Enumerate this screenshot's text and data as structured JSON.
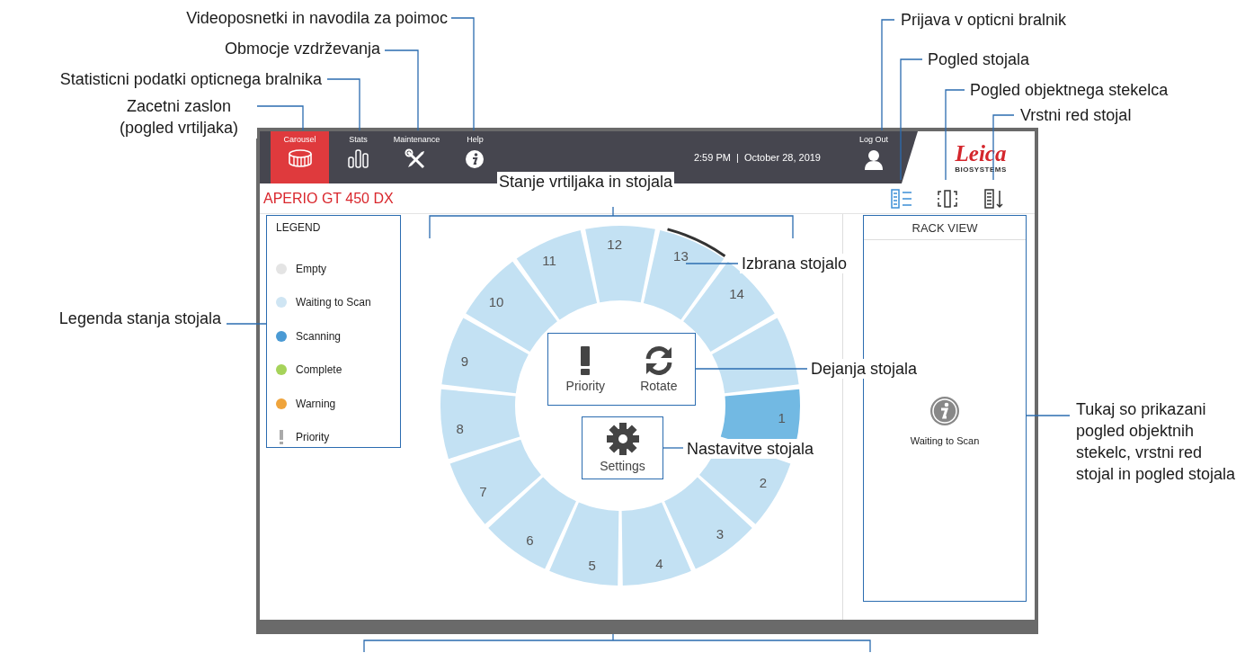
{
  "header": {
    "tabs": [
      {
        "label": "Carousel",
        "kind": "carousel",
        "selected": true
      },
      {
        "label": "Stats",
        "kind": "stats",
        "selected": false
      },
      {
        "label": "Maintenance",
        "kind": "maintenance",
        "selected": false
      },
      {
        "label": "Help",
        "kind": "help",
        "selected": false
      }
    ],
    "datetime": "2:59 PM  |  October 28, 2019",
    "logout": "Log Out",
    "logo": {
      "name": "Leica",
      "subtitle": "BIOSYSTEMS"
    }
  },
  "toolbar": {
    "title": "APERIO GT 450 DX",
    "views": [
      {
        "kind": "rack",
        "selected": true
      },
      {
        "kind": "slide",
        "selected": false
      },
      {
        "kind": "order",
        "selected": false
      }
    ]
  },
  "legend": {
    "title": "LEGEND",
    "items": [
      {
        "label": "Empty",
        "kind": "dot",
        "color": "#e4e4e4"
      },
      {
        "label": "Waiting to Scan",
        "kind": "dot",
        "color": "#cfe5f3"
      },
      {
        "label": "Scanning",
        "kind": "dot",
        "color": "#4a9ad4"
      },
      {
        "label": "Complete",
        "kind": "dot",
        "color": "#a6d35a"
      },
      {
        "label": "Warning",
        "kind": "dot",
        "color": "#efa43c"
      },
      {
        "label": "Priority",
        "kind": "priority"
      }
    ]
  },
  "carousel": {
    "racks": [
      {
        "number": "1",
        "kind": "scanning",
        "selected": false
      },
      {
        "number": "2",
        "kind": "waiting",
        "selected": false
      },
      {
        "number": "3",
        "kind": "waiting",
        "selected": false
      },
      {
        "number": "4",
        "kind": "waiting",
        "selected": false
      },
      {
        "number": "5",
        "kind": "waiting",
        "selected": false
      },
      {
        "number": "6",
        "kind": "waiting",
        "selected": false
      },
      {
        "number": "7",
        "kind": "waiting",
        "selected": false
      },
      {
        "number": "8",
        "kind": "waiting",
        "selected": false
      },
      {
        "number": "9",
        "kind": "waiting",
        "selected": false
      },
      {
        "number": "10",
        "kind": "waiting",
        "selected": false
      },
      {
        "number": "11",
        "kind": "waiting",
        "selected": false
      },
      {
        "number": "12",
        "kind": "waiting",
        "selected": false
      },
      {
        "number": "13",
        "kind": "waiting",
        "selected": true
      },
      {
        "number": "14",
        "kind": "waiting",
        "selected": false
      },
      {
        "kind": "waiting",
        "selected": false
      }
    ],
    "actions": [
      {
        "label": "Priority",
        "kind": "priority"
      },
      {
        "label": "Rotate",
        "kind": "rotate"
      }
    ],
    "settings": {
      "label": "Settings"
    }
  },
  "rack_view": {
    "title": "RACK VIEW",
    "message": "Waiting to Scan"
  },
  "callouts": [
    {
      "text": "Videoposnetki in navodila za poimoc"
    },
    {
      "text": "Obmocje vzdrževanja"
    },
    {
      "text": "Statisticni podatki opticnega bralnika"
    },
    {
      "text": "Zacetni zaslon (pogled vrtiljaka)"
    },
    {
      "text": "Prijava v opticni bralnik"
    },
    {
      "text": "Pogled stojala"
    },
    {
      "text": "Pogled objektnega stekelca"
    },
    {
      "text": "Vrstni red stojal"
    },
    {
      "text": "Stanje vrtiljaka in stojala"
    },
    {
      "text": "Izbrana stojalo"
    },
    {
      "text": "Legenda stanja stojala"
    },
    {
      "text": "Dejanja stojala"
    },
    {
      "text": "Nastavitve stojala"
    },
    {
      "text": "Tukaj so prikazani pogled objektnih stekelc, vrstni red stojal in pogled stojala"
    }
  ]
}
